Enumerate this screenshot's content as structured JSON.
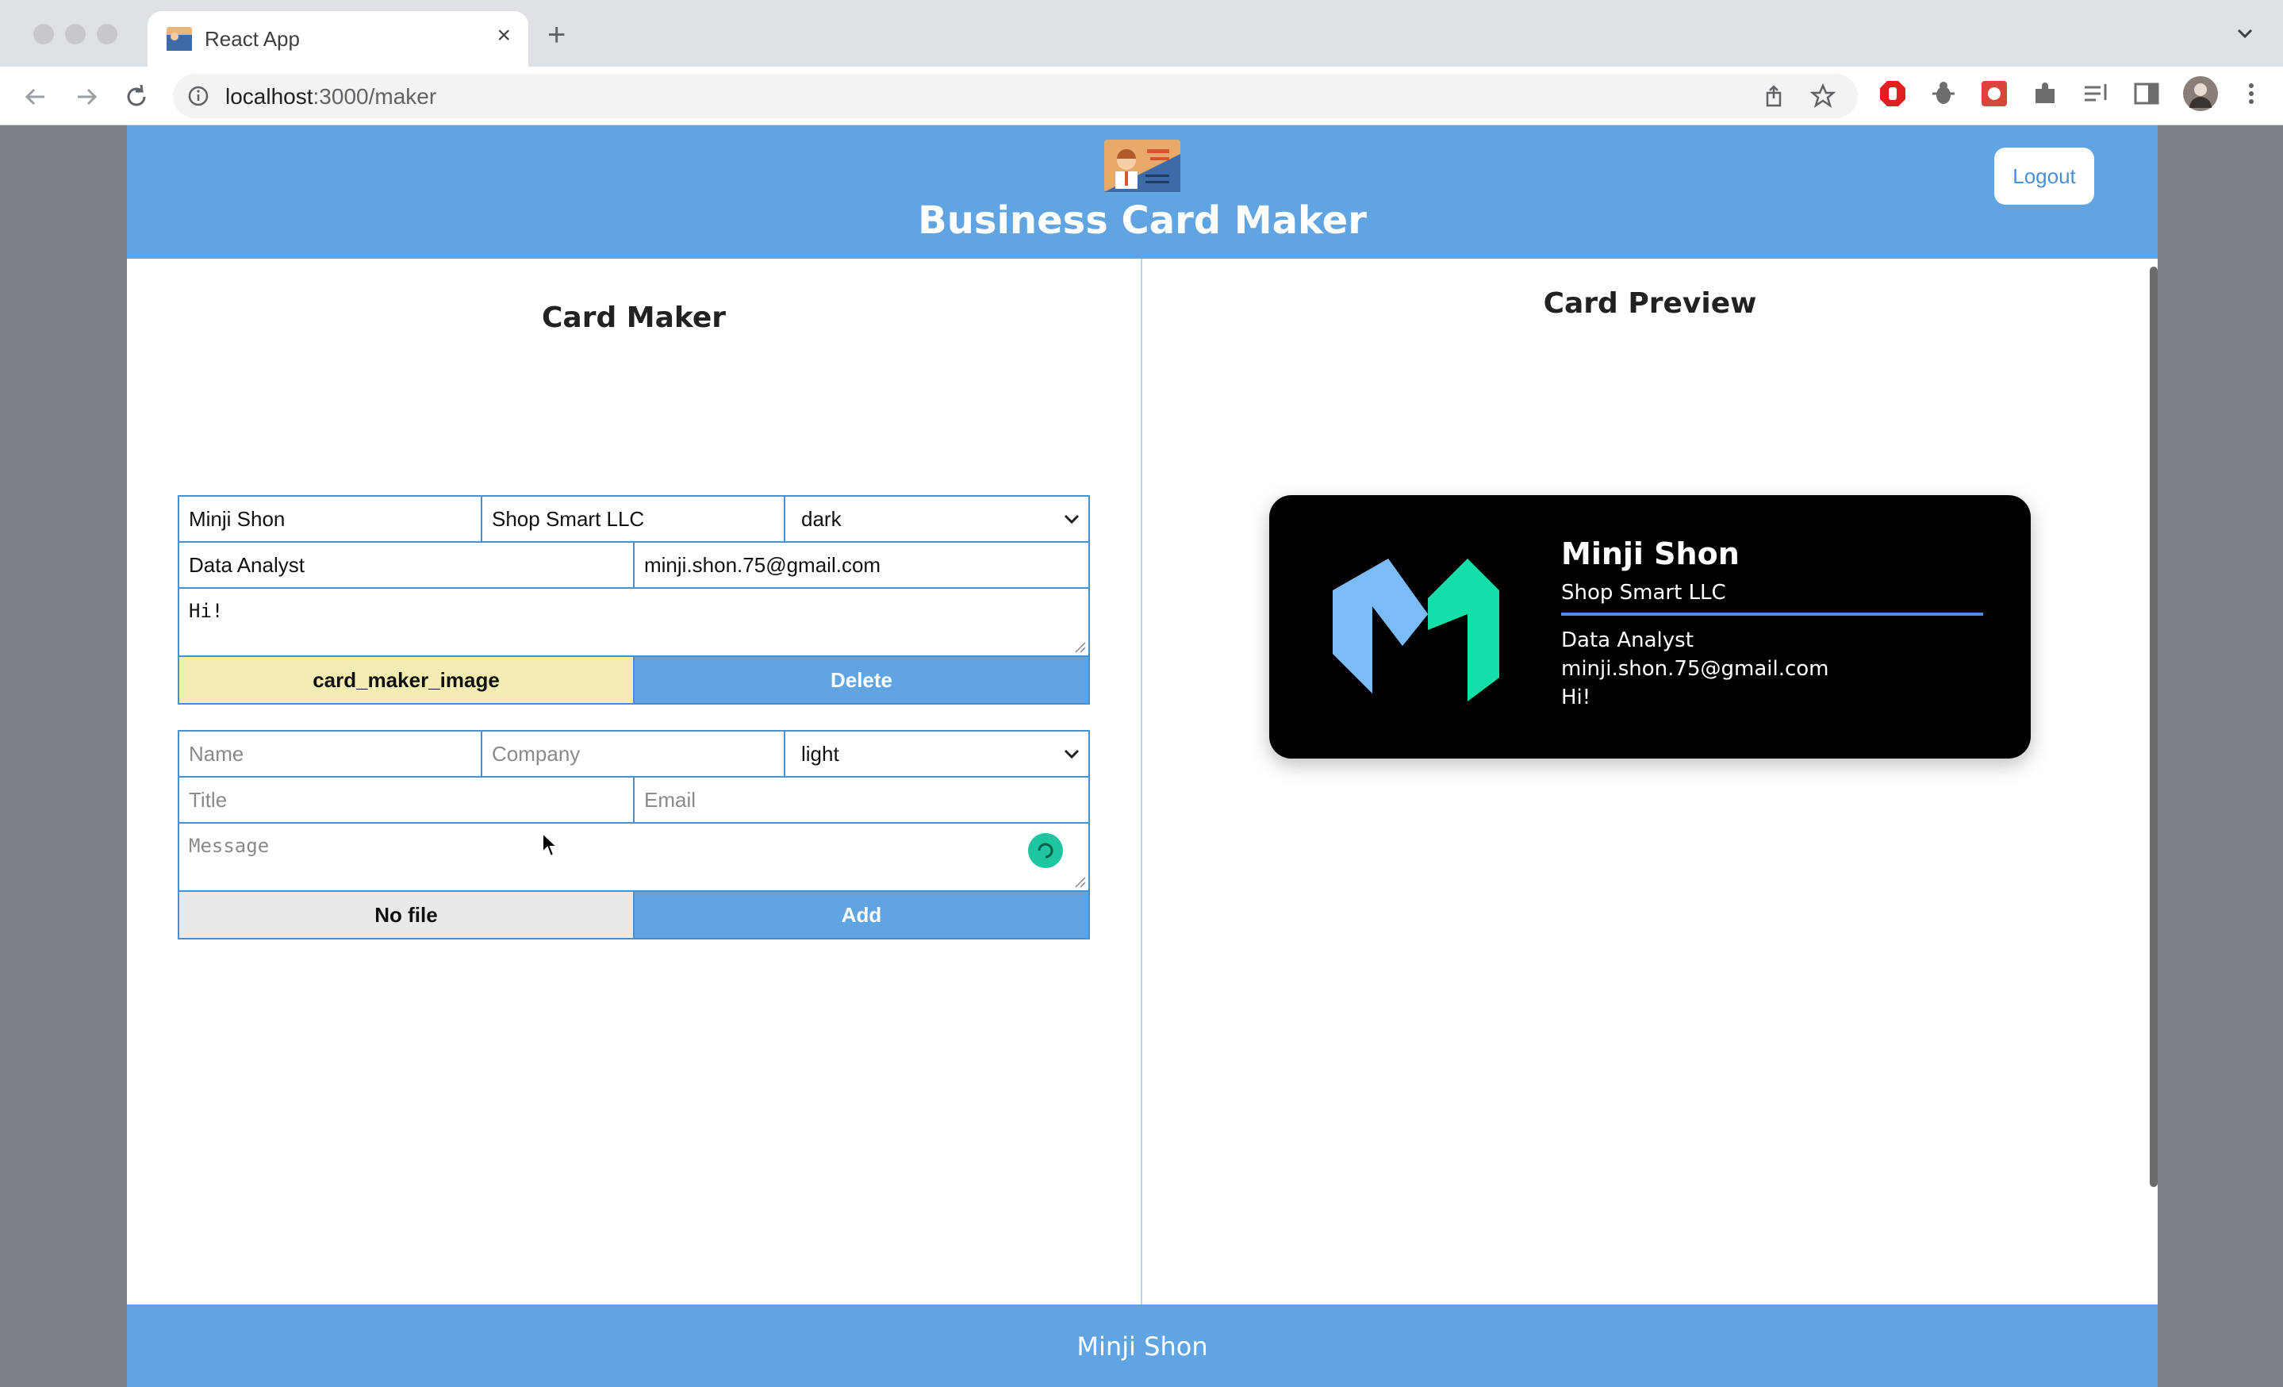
{
  "browser": {
    "tab_title": "React App",
    "url_host": "localhost",
    "url_path": ":3000/maker"
  },
  "header": {
    "title": "Business Card Maker",
    "logout_label": "Logout"
  },
  "maker": {
    "title": "Card Maker",
    "card1": {
      "name": "Minji Shon",
      "company": "Shop Smart LLC",
      "theme": "dark",
      "title": "Data Analyst",
      "email": "minji.shon.75@gmail.com",
      "message": "Hi!",
      "file_label": "card_maker_image",
      "action_label": "Delete"
    },
    "add_form": {
      "name_placeholder": "Name",
      "company_placeholder": "Company",
      "theme": "light",
      "title_placeholder": "Title",
      "email_placeholder": "Email",
      "message_placeholder": "Message",
      "file_label": "No file",
      "action_label": "Add"
    }
  },
  "preview": {
    "title": "Card Preview",
    "card": {
      "name": "Minji Shon",
      "company": "Shop Smart LLC",
      "title": "Data Analyst",
      "email": "minji.shon.75@gmail.com",
      "message": "Hi!"
    }
  },
  "footer": {
    "text": "Minji Shon"
  },
  "colors": {
    "header_blue": "#61a4e2",
    "file_button_yellow": "#f3edb4",
    "card_background": "#000000"
  }
}
